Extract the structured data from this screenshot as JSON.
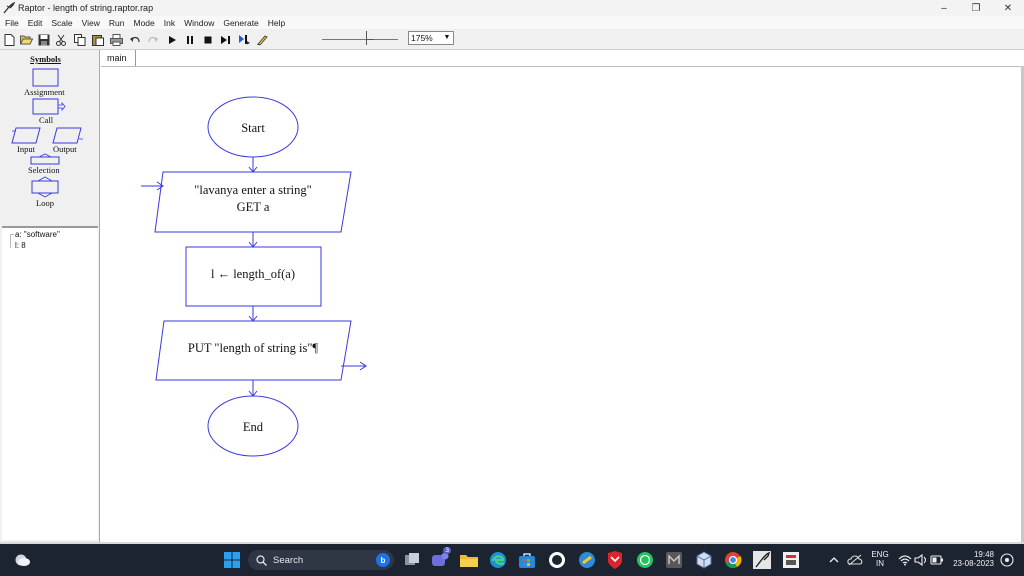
{
  "window": {
    "title": "Raptor - length of string.raptor.rap"
  },
  "menu": [
    "File",
    "Edit",
    "Scale",
    "View",
    "Run",
    "Mode",
    "Ink",
    "Window",
    "Generate",
    "Help"
  ],
  "toolbar": {
    "zoom_value": "175%",
    "icons": [
      "new-file-icon",
      "open-folder-icon",
      "save-icon",
      "cut-icon",
      "copy-icon",
      "paste-icon",
      "print-icon",
      "undo-icon",
      "redo-icon",
      "play-icon",
      "pause-icon",
      "stop-icon",
      "step-icon",
      "step-into-icon",
      "pen-icon"
    ]
  },
  "symbols_panel": {
    "title": "Symbols",
    "items": {
      "assignment": "Assignment",
      "call": "Call",
      "input": "Input",
      "output": "Output",
      "selection": "Selection",
      "loop": "Loop"
    }
  },
  "watch": {
    "vars": [
      "a: \"software\"",
      "l: 8"
    ]
  },
  "tabs": [
    "main"
  ],
  "flowchart": {
    "start": "Start",
    "input_prompt": "\"lavanya enter a string\"",
    "input_get": "GET  a",
    "assignment": "l ← length_of(a)",
    "output": "PUT  \"length of string is\"¶",
    "end": "End"
  },
  "taskbar": {
    "search_placeholder": "Search",
    "language": "ENG",
    "region": "IN",
    "time": "19:48",
    "date": "23-08-2023",
    "teams_badge": "3"
  },
  "colors": {
    "flow_stroke": "#3a3adf",
    "taskbar_bg": "#1c2432"
  }
}
